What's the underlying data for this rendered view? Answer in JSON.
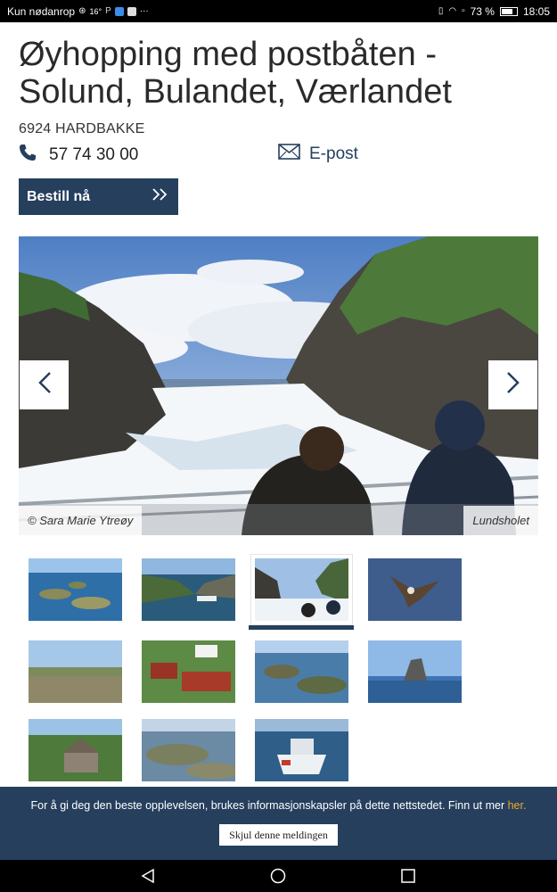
{
  "status_bar": {
    "carrier": "Kun nødanrop",
    "temperature": "16°",
    "battery": "73 %",
    "battery_level": 0.73,
    "time": "18:05",
    "icons": [
      "alarm-icon",
      "pinterest-icon",
      "app-icon",
      "facebook-icon",
      "more-icon",
      "vibrate-icon",
      "wifi-icon",
      "sim-icon",
      "battery-icon"
    ]
  },
  "page": {
    "title": "Øyhopping med postbåten - Solund, Bulandet, Værlandet",
    "address": "6924 HARDBAKKE",
    "phone": "57 74 30 00",
    "email_label": "E-post",
    "book_label": "Bestill nå"
  },
  "gallery": {
    "credit": "© Sara Marie Ytreøy",
    "place": "Lundsholet",
    "prev_icon": "chevron-left-icon",
    "next_icon": "chevron-right-icon",
    "active_thumb": 2,
    "thumb_count": 11
  },
  "cookie": {
    "text": "For å gi deg den beste opplevelsen, brukes informasjonskapsler på dette nettstedet. Finn ut mer ",
    "link": "her.",
    "button": "Skjul denne meldingen"
  },
  "colors": {
    "brand": "#253f5d",
    "link_accent": "#f0a92a"
  }
}
